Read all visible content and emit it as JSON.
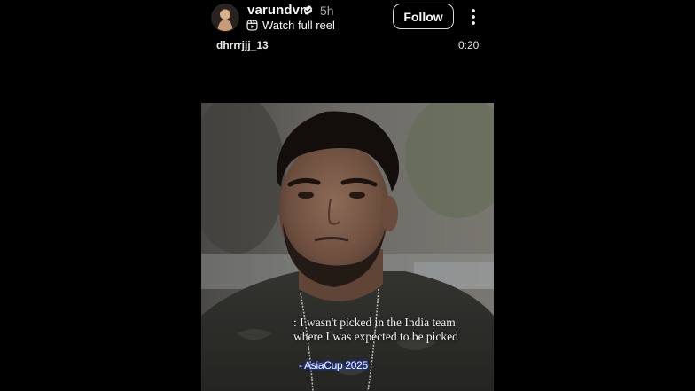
{
  "post_header": {
    "username": "varundvn",
    "timestamp": "5h",
    "watch_link": "Watch full reel",
    "follow_label": "Follow",
    "avatar_icon": "profile-avatar",
    "verified_icon": "verified-badge-icon",
    "reel_icon": "reels-icon",
    "more_icon": "more-options-icon"
  },
  "reel": {
    "audio_username": "dhrrrjjj_13",
    "duration": "0:20",
    "caption_lines": [
      ": I wasn't picked in the India team",
      "where I was expected to be picked"
    ],
    "tagline": "- AsiaCup 2025"
  },
  "colors": {
    "background": "#000000",
    "text_primary": "#f5f5f5",
    "text_secondary": "#a8a8a8",
    "verified_blue": "#0095f6",
    "tagline_glow": "#1a4aff"
  }
}
